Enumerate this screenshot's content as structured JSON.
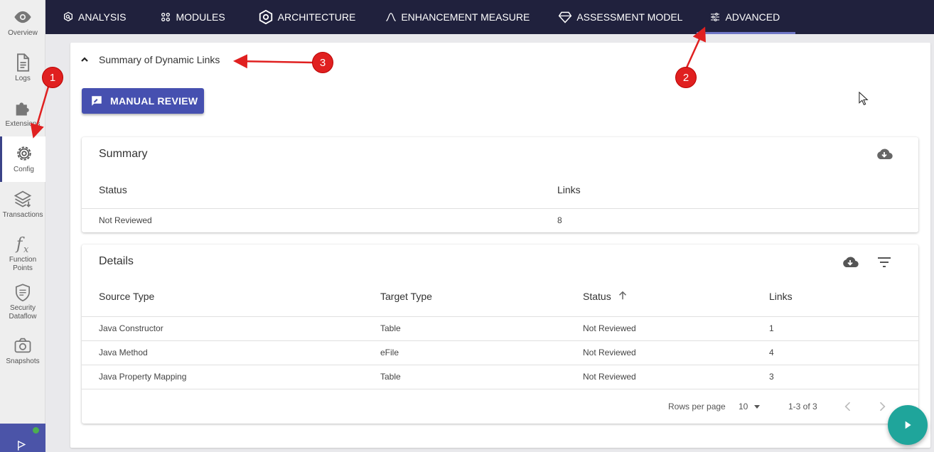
{
  "sidebar": {
    "items": [
      {
        "label": "Overview",
        "icon": "eye-icon"
      },
      {
        "label": "Logs",
        "icon": "document-icon"
      },
      {
        "label": "Extensions",
        "icon": "puzzle-icon"
      },
      {
        "label": "Config",
        "icon": "gear-icon"
      },
      {
        "label": "Transactions",
        "icon": "layers-icon"
      },
      {
        "label": "Function Points",
        "icon": "function-icon"
      },
      {
        "label": "Security Dataflow",
        "icon": "shield-icon"
      },
      {
        "label": "Snapshots",
        "icon": "camera-icon"
      }
    ],
    "active": "Config"
  },
  "topnav": {
    "tabs": [
      {
        "label": "ANALYSIS",
        "icon": "analysis-icon"
      },
      {
        "label": "MODULES",
        "icon": "modules-icon"
      },
      {
        "label": "ARCHITECTURE",
        "icon": "architecture-icon"
      },
      {
        "label": "ENHANCEMENT MEASURE",
        "icon": "curve-icon"
      },
      {
        "label": "ASSESSMENT MODEL",
        "icon": "diamond-icon"
      },
      {
        "label": "ADVANCED",
        "icon": "sliders-icon"
      }
    ],
    "active": "ADVANCED"
  },
  "section": {
    "title": "Summary of Dynamic Links",
    "manual_review_label": "MANUAL REVIEW"
  },
  "summary": {
    "title": "Summary",
    "columns": [
      "Status",
      "Links"
    ],
    "rows": [
      [
        "Not Reviewed",
        "8"
      ]
    ]
  },
  "details": {
    "title": "Details",
    "columns": [
      "Source Type",
      "Target Type",
      "Status",
      "Links"
    ],
    "rows": [
      [
        "Java Constructor",
        "Table",
        "Not Reviewed",
        "1"
      ],
      [
        "Java Method",
        "eFile",
        "Not Reviewed",
        "4"
      ],
      [
        "Java Property Mapping",
        "Table",
        "Not Reviewed",
        "3"
      ]
    ],
    "rows_per_page_label": "Rows per page",
    "rows_per_page_value": "10",
    "range_label": "1-3 of 3"
  },
  "annotations": [
    "1",
    "2",
    "3"
  ],
  "colors": {
    "topnav_bg": "#20213d",
    "primary_button": "#4650b0",
    "fab": "#1fa59b",
    "annotation": "#e02020"
  }
}
